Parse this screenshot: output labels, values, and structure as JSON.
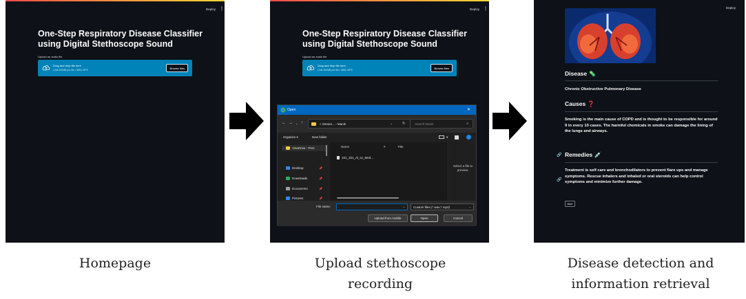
{
  "homepage": {
    "deploy_label": "Deploy",
    "title": "One-Step Respiratory Disease Classifier using Digital Stethoscope Sound",
    "upload_label": "Upload an audio file",
    "dropzone_text": "Drag and drop file here",
    "dropzone_limit": "Limit 200MB per file • WAV, MP3",
    "browse_label": "Browse files"
  },
  "upload": {
    "deploy_label": "Deploy",
    "title": "One-Step Respiratory Disease Classifier using Digital Stethoscope Sound",
    "upload_label": "Upload an audio file",
    "dropzone_text": "Drag and drop file here",
    "dropzone_limit": "Limit 200MB per file • WAV, MP3",
    "browse_label": "Browse files",
    "dialog": {
      "title": "Open",
      "path": "« Stream... › Manik",
      "search_placeholder": "Search Manik",
      "organize": "Organize ▾",
      "new_folder": "New folder",
      "sidebar": [
        {
          "label": "OneDrive - Pers",
          "color": "#f2c94c"
        },
        {
          "label": "Desktop",
          "color": "#2d8cf0"
        },
        {
          "label": "Downloads",
          "color": "#27ae60"
        },
        {
          "label": "Documents",
          "color": "#9aa0a6"
        },
        {
          "label": "Pictures",
          "color": "#2d8cf0"
        }
      ],
      "columns": [
        "Name",
        "#",
        "Title"
      ],
      "files": [
        "101_1b1_Al_sc_Med..."
      ],
      "preview_text": "Select a file to preview.",
      "file_name_label": "File name:",
      "file_type": "Custom files (*.wav;*.mp3)",
      "upload_mobile": "Upload from mobile",
      "open_btn": "Open",
      "cancel_btn": "Cancel"
    }
  },
  "result": {
    "deploy_label": "Deploy",
    "disease_heading": "Disease 🦠",
    "disease_name": "Chronic Obstructive Pulmonary Disease",
    "causes_heading": "Causes ❓",
    "causes_text": "Smoking is the main cause of COPD and is thought to be responsible for around 9 in every 10 cases. The harmful chemicals in smoke can damage the lining of the lungs and airways.",
    "remedies_heading": "Remedies 💉",
    "remedies_text": "Treatment is self care and bronchodilators to prevent flare ups and manage symptoms. Rescue inhalers and inhaled or oral steroids can help control symptoms and minimize further damage.",
    "more_label": "More"
  },
  "captions": {
    "homepage": "Homepage",
    "upload": "Upload stethoscope recording",
    "result": "Disease detection and information retrieval"
  },
  "colors": {
    "app_bg": "#0e1117",
    "dropzone": "#0083b8",
    "dialog_accent": "#0067c0"
  }
}
